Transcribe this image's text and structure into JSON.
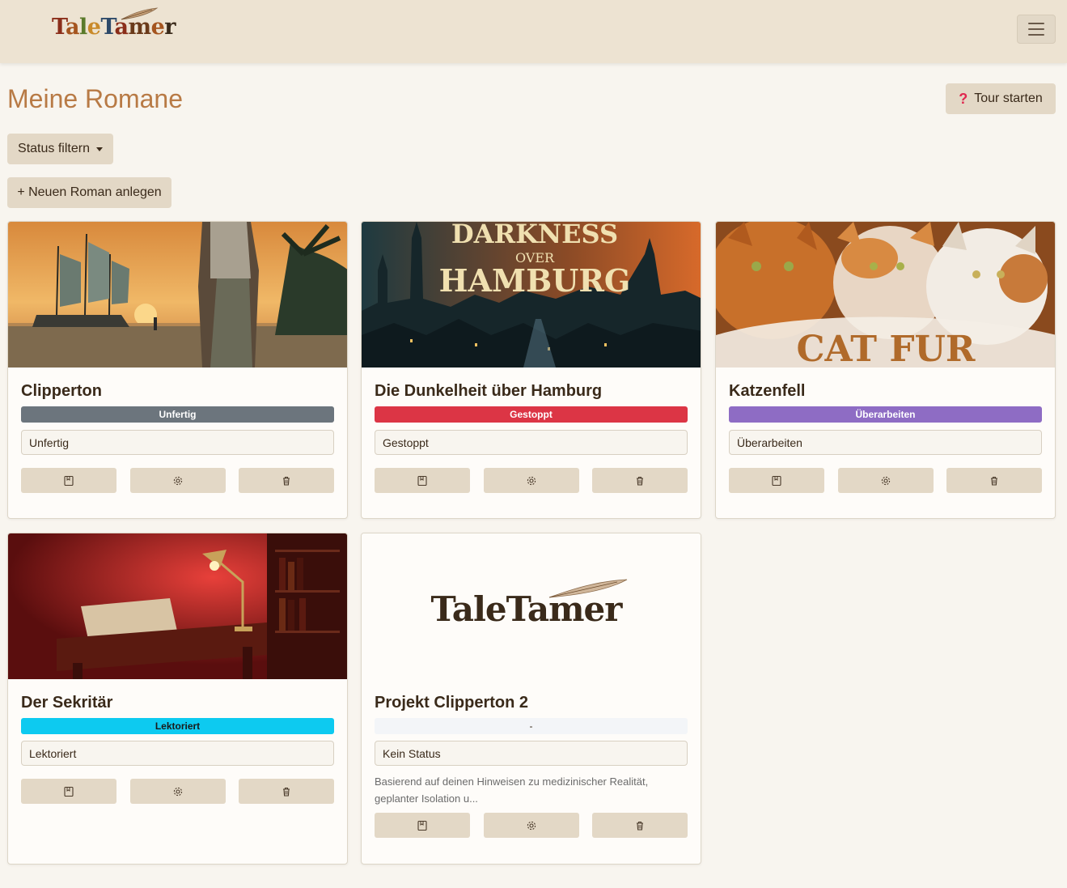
{
  "app": {
    "logo_text": "TaleTamer",
    "logo_letters": [
      "T",
      "a",
      "l",
      "e",
      "T",
      "a",
      "m",
      "e",
      "r"
    ],
    "logo_colors": [
      "#8b2e1a",
      "#a5551f",
      "#5a7a2a",
      "#c98a2a",
      "#2e4a6a",
      "#8b2e1a",
      "#6a3a1a",
      "#a5551f",
      "#3a2a1a"
    ]
  },
  "header": {
    "menu_icon": "hamburger-icon"
  },
  "page": {
    "title": "Meine Romane",
    "tour_label": "Tour starten",
    "tour_icon": "question-icon",
    "filter_label": "Status filtern",
    "new_label": "+ Neuen Roman anlegen"
  },
  "colors": {
    "accent": "#b87a45",
    "button_bg": "#e3d8c6",
    "badge_unfertig": "#6c757d",
    "badge_gestoppt": "#dc3545",
    "badge_ueberarbeiten": "#8e6cc4",
    "badge_lektoriert": "#0dcaf0",
    "badge_none": "#f3f5f8"
  },
  "novels": [
    {
      "title": "Clipperton",
      "badge": "Unfertig",
      "status": "Unfertig",
      "description": "",
      "cover": "ship-sunset-illustration"
    },
    {
      "title": "Die Dunkelheit über Hamburg",
      "badge": "Gestoppt",
      "status": "Gestoppt",
      "description": "",
      "cover_text_line1": "DARKNESS",
      "cover_text_line2": "OVER",
      "cover_text_line3": "HAMBURG"
    },
    {
      "title": "Katzenfell",
      "badge": "Überarbeiten",
      "status": "Überarbeiten",
      "description": "",
      "cover_text": "CAT FUR"
    },
    {
      "title": "Der Sekritär",
      "badge": "Lektoriert",
      "status": "Lektoriert",
      "description": "",
      "cover": "desk-lamp-illustration"
    },
    {
      "title": "Projekt Clipperton 2",
      "badge": "-",
      "status": "Kein Status",
      "description": "Basierend auf deinen Hinweisen zu medizinischer Realität, geplanter Isolation u...",
      "cover_logo": "TaleTamer"
    }
  ],
  "action_icons": [
    "open-book-icon",
    "gear-icon",
    "trash-icon"
  ]
}
